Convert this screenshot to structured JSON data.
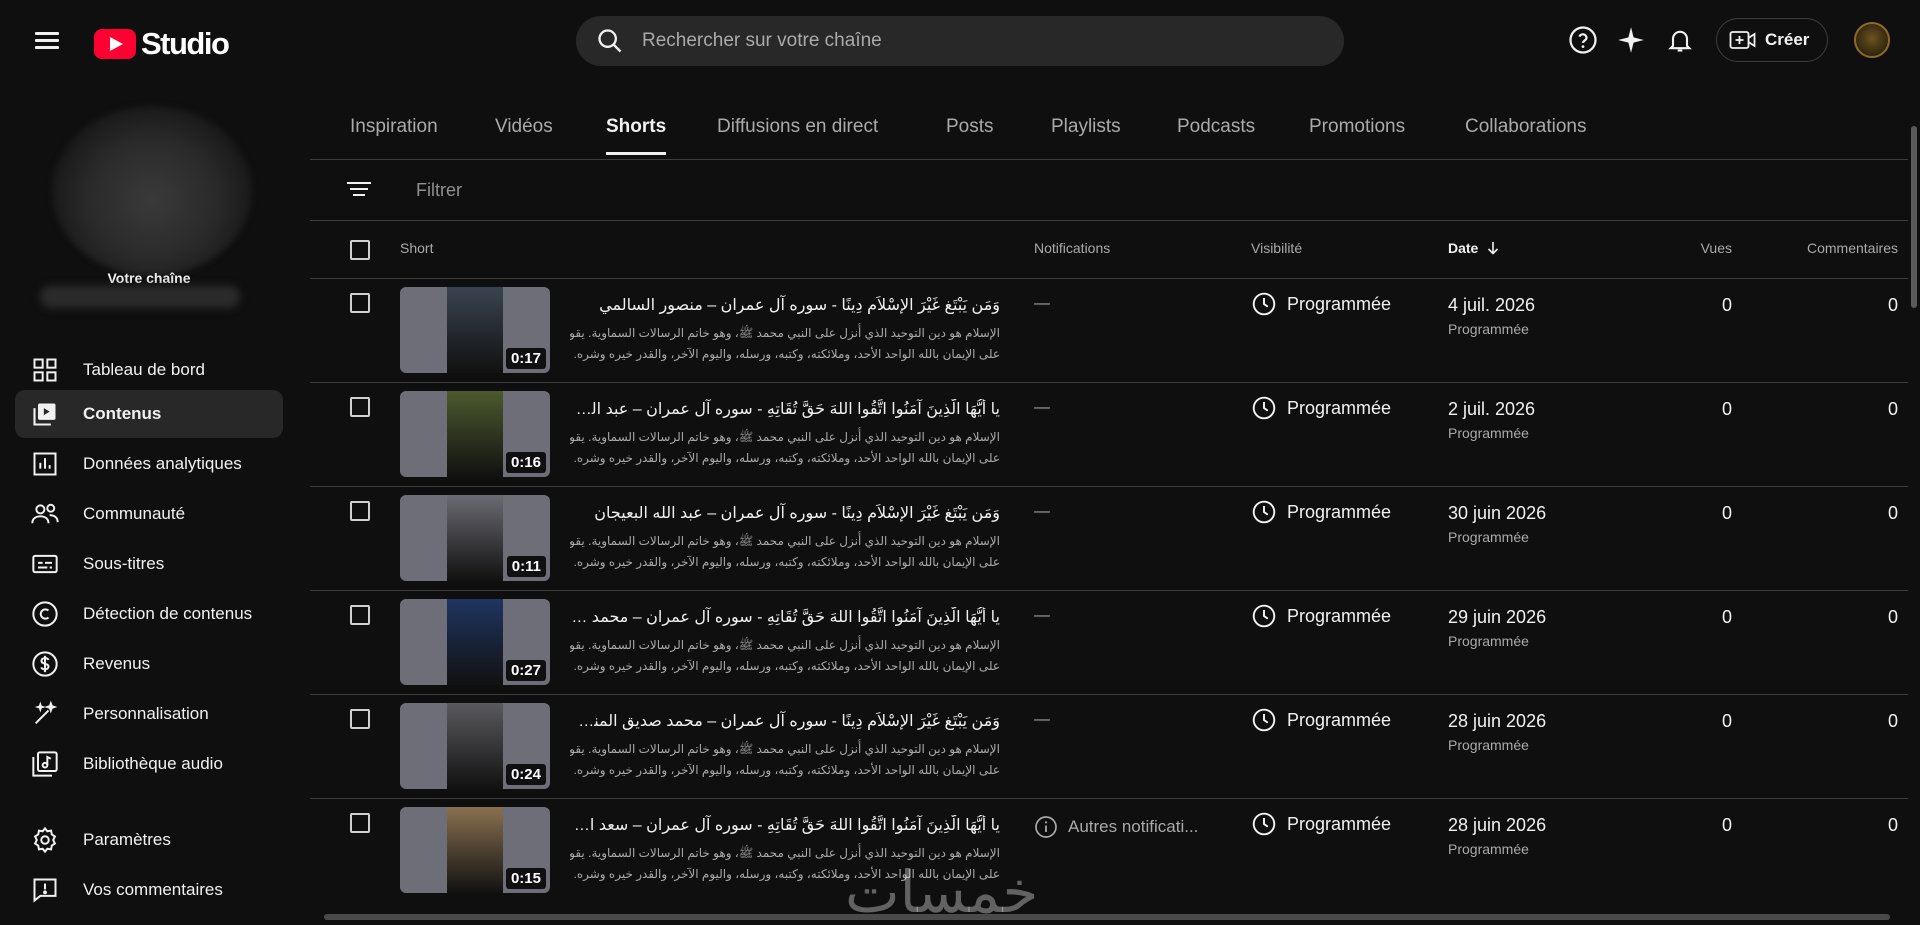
{
  "header": {
    "app_name": "Studio",
    "search_placeholder": "Rechercher sur votre chaîne",
    "create_label": "Créer"
  },
  "sidebar": {
    "channel_label": "Votre chaîne",
    "items": [
      {
        "label": "Tableau de bord",
        "icon": "dashboard-icon"
      },
      {
        "label": "Contenus",
        "icon": "content-icon",
        "active": true
      },
      {
        "label": "Données analytiques",
        "icon": "analytics-icon"
      },
      {
        "label": "Communauté",
        "icon": "community-icon"
      },
      {
        "label": "Sous-titres",
        "icon": "subtitles-icon"
      },
      {
        "label": "Détection de contenus",
        "icon": "copyright-icon"
      },
      {
        "label": "Revenus",
        "icon": "earn-icon"
      },
      {
        "label": "Personnalisation",
        "icon": "customization-icon"
      },
      {
        "label": "Bibliothèque audio",
        "icon": "audio-library-icon"
      }
    ],
    "bottom_items": [
      {
        "label": "Paramètres",
        "icon": "settings-icon"
      },
      {
        "label": "Vos commentaires",
        "icon": "feedback-icon"
      }
    ]
  },
  "tabs": [
    "Inspiration",
    "Vidéos",
    "Shorts",
    "Diffusions en direct",
    "Posts",
    "Playlists",
    "Podcasts",
    "Promotions",
    "Collaborations"
  ],
  "active_tab": "Shorts",
  "filter": {
    "placeholder": "Filtrer"
  },
  "table": {
    "headers": {
      "short": "Short",
      "notifications": "Notifications",
      "visibility": "Visibilité",
      "date": "Date",
      "views": "Vues",
      "comments": "Commentaires"
    },
    "desc_lines": [
      "الإسلام هو دين التوحيد الذي أُنزل على النبي محمد ﷺ، وهو خاتم الرسالات السماوية. يقوم",
      "على الإيمان بالله الواحد الأحد، وملائكته، وكتبه، ورسله، واليوم الآخر، والقدر خيره وشره."
    ],
    "rows": [
      {
        "title": "وَمَن يَبْتَغِ غَيْرَ الإِسْلاَمِ دِينًا - سوره آل عمران – منصور السالمي",
        "duration": "0:17",
        "notification": "—",
        "visibility": "Programmée",
        "date": "4 juil. 2026",
        "date_status": "Programmée",
        "views": "0",
        "comments": "0",
        "thumb_color": "#3a4450"
      },
      {
        "title": "يا أَيُّهَا الَّذِينَ آمَنُوا اتَّقُوا اللهَ حَقَّ تُقَاتِهِ - سوره آل عمران – عبد الرحمان السديس",
        "duration": "0:16",
        "notification": "—",
        "visibility": "Programmée",
        "date": "2 juil. 2026",
        "date_status": "Programmée",
        "views": "0",
        "comments": "0",
        "thumb_color": "#4c5a2e"
      },
      {
        "title": "وَمَن يَبْتَغِ غَيْرَ الإِسْلاَمِ دِينًا - سوره آل عمران – عبد الله البعيجان",
        "duration": "0:11",
        "notification": "—",
        "visibility": "Programmée",
        "date": "30 juin 2026",
        "date_status": "Programmée",
        "views": "0",
        "comments": "0",
        "thumb_color": "#6a6a72"
      },
      {
        "title": "يا أَيُّهَا الَّذِينَ آمَنُوا اتَّقُوا اللهَ حَقَّ تُقَاتِهِ - سوره آل عمران – محمد صديق المنشاوي",
        "duration": "0:27",
        "notification": "—",
        "visibility": "Programmée",
        "date": "29 juin 2026",
        "date_status": "Programmée",
        "views": "0",
        "comments": "0",
        "thumb_color": "#1f3560"
      },
      {
        "title": "وَمَن يَبْتَغِ غَيْرَ الإِسْلاَمِ دِينًا - سوره آل عمران – محمد صديق المنشاوي",
        "duration": "0:24",
        "notification": "—",
        "visibility": "Programmée",
        "date": "28 juin 2026",
        "date_status": "Programmée",
        "views": "0",
        "comments": "0",
        "thumb_color": "#5a5a5e"
      },
      {
        "title": "يا أَيُّهَا الَّذِينَ آمَنُوا اتَّقُوا اللهَ حَقَّ تُقَاتِهِ - سوره آل عمران – سعد الغامدي",
        "duration": "0:15",
        "notification": "Autres notificati...",
        "visibility": "Programmée",
        "date": "28 juin 2026",
        "date_status": "Programmée",
        "views": "0",
        "comments": "0",
        "thumb_color": "#8a7050"
      }
    ]
  },
  "watermark": "خمسات",
  "colors": {
    "brand_red": "#ff0033",
    "background": "#0f0f0f",
    "active_nav": "#282828"
  }
}
